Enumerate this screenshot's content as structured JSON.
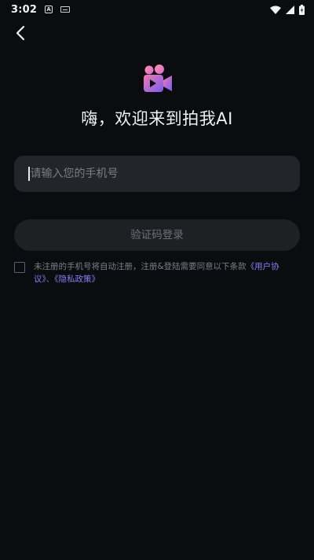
{
  "status_bar": {
    "time": "3:02",
    "notif_icon_letter": "A"
  },
  "header": {
    "welcome": "嗨，欢迎来到拍我AI"
  },
  "form": {
    "phone_placeholder": "请输入您的手机号",
    "login_button": "验证码登录"
  },
  "agreement": {
    "text": "未注册的手机号将自动注册，注册&登陆需要同意以下条款",
    "user_agreement": "《用户协议》",
    "separator": "、",
    "privacy_policy": "《隐私政策》"
  },
  "colors": {
    "background": "#0b0c0f",
    "input_bg": "#23252a",
    "button_bg": "#1e2024",
    "link": "#8c7cf5",
    "logo_gradient_start": "#f27ab0",
    "logo_gradient_end": "#7a5cf0"
  },
  "icons": [
    "back-arrow-icon",
    "wifi-icon",
    "signal-icon",
    "battery-icon",
    "camera-logo-icon"
  ]
}
